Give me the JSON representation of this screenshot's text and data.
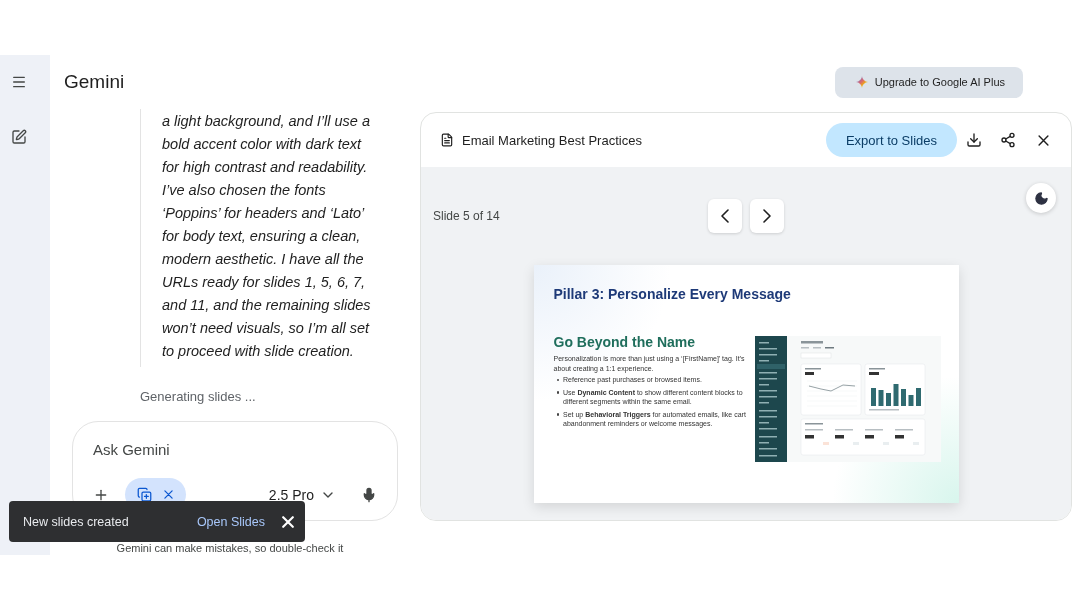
{
  "header": {
    "title": "Gemini",
    "upgrade_label": "Upgrade to Google AI Plus"
  },
  "chat": {
    "response": "a light background, and I’ll use a bold accent color with dark text for high contrast and readability. I’ve also chosen the fonts ‘Poppins’ for headers and ‘Lato’ for body text, ensuring a clean, modern aesthetic. I have all the URLs ready for slides 1, 5, 6, 7, and 11, and the remaining slides won’t need visuals, so I’m all set to proceed with slide creation.",
    "status": "Generating slides ...",
    "disclaimer": "Gemini can make mistakes, so double-check it"
  },
  "composer": {
    "placeholder": "Ask Gemini",
    "model": "2.5 Pro"
  },
  "toast": {
    "message": "New slides created",
    "action": "Open Slides"
  },
  "canvas": {
    "title": "Email Marketing Best Practices",
    "export_label": "Export to Slides",
    "counter": "Slide 5 of 14",
    "slide": {
      "title": "Pillar 3: Personalize Every Message",
      "heading": "Go Beyond the Name",
      "intro": "Personalization is more than just using a ‘[FirstName]’ tag. It’s about creating a 1:1 experience.",
      "bullets": [
        "Reference past purchases or browsed items.",
        "Use **Dynamic Content** to show different content blocks to different segments within the same email.",
        "Set up **Behavioral Triggers** for automated emails, like cart abandonment reminders or welcome messages."
      ]
    }
  }
}
